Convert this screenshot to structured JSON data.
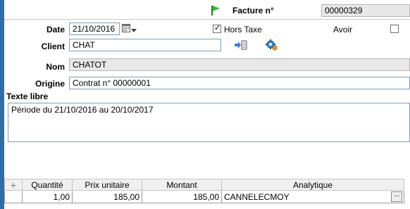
{
  "header": {
    "invoice_label": "Facture n°",
    "invoice_number": "00000329"
  },
  "date": {
    "label": "Date",
    "value": "21/10/2016"
  },
  "hors_taxe": {
    "label": "Hors Taxe",
    "checked": true
  },
  "avoir": {
    "label": "Avoir",
    "checked": false
  },
  "client": {
    "label": "Client",
    "value": "CHAT"
  },
  "nom": {
    "label": "Nom",
    "value": "CHATOT"
  },
  "origine": {
    "label": "Origine",
    "value": "Contrat n° 00000001"
  },
  "texte_libre": {
    "label": "Texte libre",
    "value": "Période du 21/10/2016 au 20/10/2017"
  },
  "table": {
    "add_symbol": "+",
    "columns": [
      "Quantité",
      "Prix unitaire",
      "Montant",
      "Analytique"
    ],
    "rows": [
      {
        "quantite": "1,00",
        "prix": "185,00",
        "montant": "185,00",
        "analytique": "CANNELECMOY"
      }
    ],
    "ellipsis": "..."
  },
  "colors": {
    "accent_border": "#2f6da8",
    "flag": "#2fbf2f",
    "readonly_bg": "#e8e8e8"
  }
}
